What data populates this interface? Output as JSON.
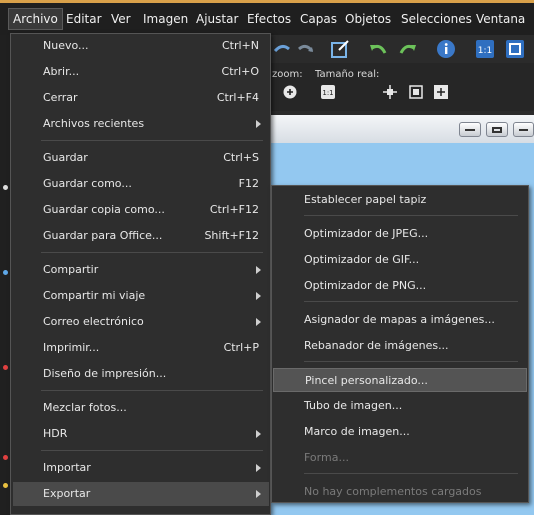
{
  "menubar": {
    "items": [
      "Archivo",
      "Editar",
      "Ver",
      "Imagen",
      "Ajustar",
      "Efectos",
      "Capas",
      "Objetos",
      "Selecciones",
      "Ventana"
    ]
  },
  "toolbar2": {
    "zoom_label": "zoom:",
    "real_size_label": "Tamaño real:"
  },
  "file_menu": {
    "items": [
      {
        "label": "Nuevo...",
        "shortcut": "Ctrl+N"
      },
      {
        "label": "Abrir...",
        "shortcut": "Ctrl+O"
      },
      {
        "label": "Cerrar",
        "shortcut": "Ctrl+F4"
      },
      {
        "label": "Archivos recientes",
        "shortcut": ""
      },
      {
        "label": "Guardar",
        "shortcut": "Ctrl+S"
      },
      {
        "label": "Guardar como...",
        "shortcut": "F12"
      },
      {
        "label": "Guardar copia como...",
        "shortcut": "Ctrl+F12"
      },
      {
        "label": "Guardar para Office...",
        "shortcut": "Shift+F12"
      },
      {
        "label": "Compartir",
        "shortcut": ""
      },
      {
        "label": "Compartir mi viaje",
        "shortcut": ""
      },
      {
        "label": "Correo electrónico",
        "shortcut": ""
      },
      {
        "label": "Imprimir...",
        "shortcut": "Ctrl+P"
      },
      {
        "label": "Diseño de impresión...",
        "shortcut": ""
      },
      {
        "label": "Mezclar fotos...",
        "shortcut": ""
      },
      {
        "label": "HDR",
        "shortcut": ""
      },
      {
        "label": "Importar",
        "shortcut": ""
      },
      {
        "label": "Exportar",
        "shortcut": ""
      }
    ]
  },
  "export_submenu": {
    "items": [
      {
        "label": "Establecer papel tapiz"
      },
      {
        "label": "Optimizador de JPEG..."
      },
      {
        "label": "Optimizador de GIF..."
      },
      {
        "label": "Optimizador de PNG..."
      },
      {
        "label": "Asignador de mapas a imágenes..."
      },
      {
        "label": "Rebanador de imágenes..."
      },
      {
        "label": "Pincel personalizado..."
      },
      {
        "label": "Tubo de imagen..."
      },
      {
        "label": "Marco de imagen..."
      },
      {
        "label": "Forma..."
      },
      {
        "label": "No hay complementos cargados"
      }
    ]
  },
  "colors": {
    "accent": "#d9a14a",
    "canvas": "#93c8f0",
    "menu_bg": "#2e2e2e",
    "highlight": "#545454"
  }
}
